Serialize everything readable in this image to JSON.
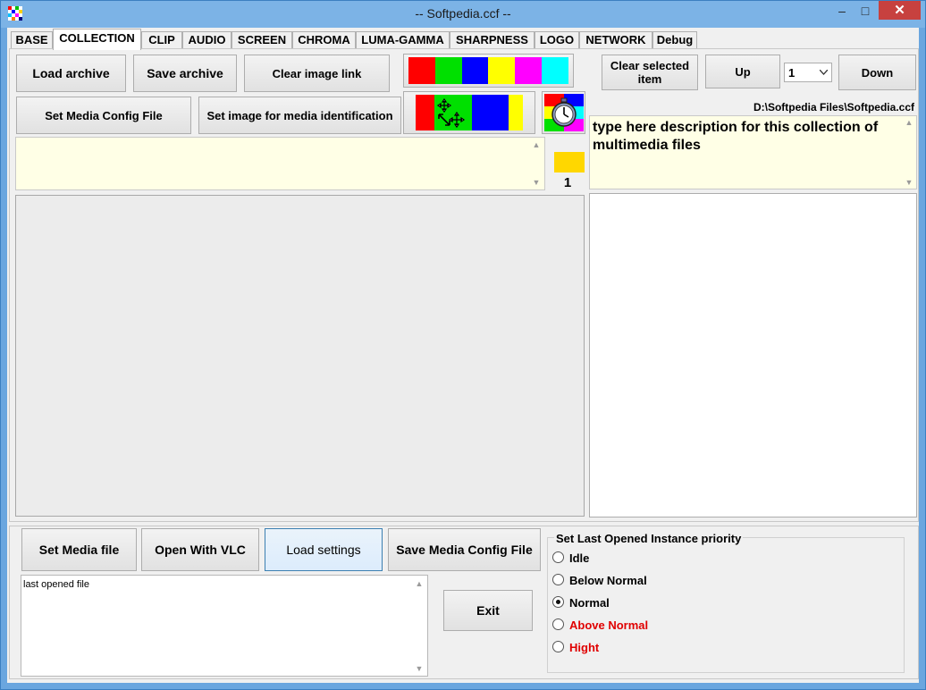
{
  "window": {
    "title": "-- Softpedia.ccf --",
    "minimize_glyph": "–",
    "maximize_glyph": "□",
    "close_glyph": "✕"
  },
  "tabs": [
    {
      "label": "BASE",
      "active": false
    },
    {
      "label": "COLLECTION",
      "active": true
    },
    {
      "label": "CLIP",
      "active": false
    },
    {
      "label": "AUDIO",
      "active": false
    },
    {
      "label": "SCREEN",
      "active": false
    },
    {
      "label": "CHROMA",
      "active": false
    },
    {
      "label": "LUMA-GAMMA",
      "active": false
    },
    {
      "label": "SHARPNESS",
      "active": false
    },
    {
      "label": "LOGO",
      "active": false
    },
    {
      "label": "NETWORK",
      "active": false
    },
    {
      "label": "Debug",
      "active": false
    }
  ],
  "collection": {
    "load_archive": "Load archive",
    "save_archive": "Save archive",
    "clear_image_link": "Clear image link",
    "set_media_config_file": "Set Media Config File",
    "set_image_for_media_identification": "Set image for media identification",
    "clear_selected_item": "Clear selected item",
    "up": "Up",
    "down": "Down",
    "index_select_value": "1",
    "file_path": "D:\\Softpedia Files\\Softpedia.ccf",
    "description": "type here description for this collection of multimedia files",
    "item_number": "1"
  },
  "bottom": {
    "set_media_file": "Set Media file",
    "open_with_vlc": "Open With VLC",
    "load_settings": "Load settings",
    "save_media_config_file": "Save Media Config File",
    "exit": "Exit",
    "last_opened_file": "last opened file"
  },
  "priority": {
    "title": "Set Last Opened Instance priority",
    "options": [
      {
        "label": "Idle",
        "selected": false,
        "color": "#000000"
      },
      {
        "label": "Below Normal",
        "selected": false,
        "color": "#000000"
      },
      {
        "label": "Normal",
        "selected": true,
        "color": "#000000"
      },
      {
        "label": "Above Normal",
        "selected": false,
        "color": "#e00000"
      },
      {
        "label": "Hight",
        "selected": false,
        "color": "#e00000"
      }
    ]
  },
  "colors": {
    "strip": [
      "#ff0000",
      "#00e000",
      "#0000ff",
      "#ffff00",
      "#ff00ff",
      "#00ffff"
    ],
    "swatch": "#ffd700",
    "accent": "#3c7fb1"
  },
  "icons": [
    "app-icon",
    "color-strip-icon",
    "resize-move-icon",
    "timer-icon",
    "scroll-up-icon",
    "scroll-down-icon",
    "dropdown-arrow-icon"
  ]
}
